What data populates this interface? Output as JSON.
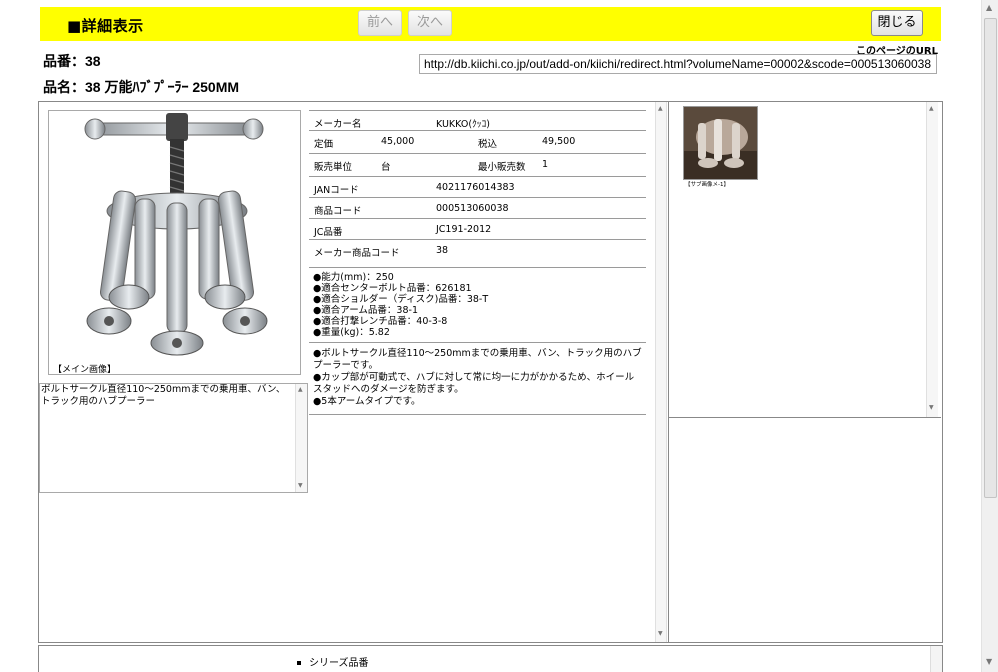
{
  "header": {
    "title": "■詳細表示",
    "prev_label": "前へ",
    "next_label": "次へ",
    "close_label": "閉じる"
  },
  "product": {
    "part_number": "品番：38",
    "part_name": "品名：38 万能ﾊﾌﾞﾌﾟｰﾗｰ 250MM"
  },
  "page_url": {
    "label": "このページのURL",
    "value": "http://db.kiichi.co.jp/out/add-on/kiichi/redirect.html?volumeName=00002&scode=000513060038"
  },
  "image": {
    "caption": "【メイン画像】",
    "description": "ボルトサークル直径110～250mmまでの乗用車、バン、トラック用のハブプーラー"
  },
  "spec": {
    "maker_label": "メーカー名",
    "maker_value": "KUKKO(ｸｯｺ)",
    "price_label": "定価",
    "price_value": "45,000",
    "tax_label": "税込",
    "tax_value": "49,500",
    "unit_label": "販売単位",
    "unit_value": "台",
    "min_label": "最小販売数",
    "min_value": "1",
    "jan_label": "JANコード",
    "jan_value": "4021176014383",
    "code_label": "商品コード",
    "code_value": "000513060038",
    "jc_label": "JC品番",
    "jc_value": "JC191-2012",
    "maker_code_label": "メーカー商品コード",
    "maker_code_value": "38"
  },
  "features": [
    "●能力(mm)：250",
    "●適合センターボルト品番：626181",
    "●適合ショルダー（ディスク)品番：38-T",
    "●適合アーム品番：38-1",
    "●適合打撃レンチ品番：40-3-8",
    "●重量(kg)：5.82"
  ],
  "comments": [
    "●ボルトサークル直径110～250mmまでの乗用車、バン、トラック用のハブプーラーです。",
    "●カップ部が可動式で、ハブに対して常に均一に力がかかるため、ホイールスタッドへのダメージを防ぎます。",
    "●5本アームタイプです。"
  ],
  "thumbnail": {
    "caption": "【サブ画像メ-1】"
  },
  "series": {
    "label": "シリーズ品番"
  }
}
